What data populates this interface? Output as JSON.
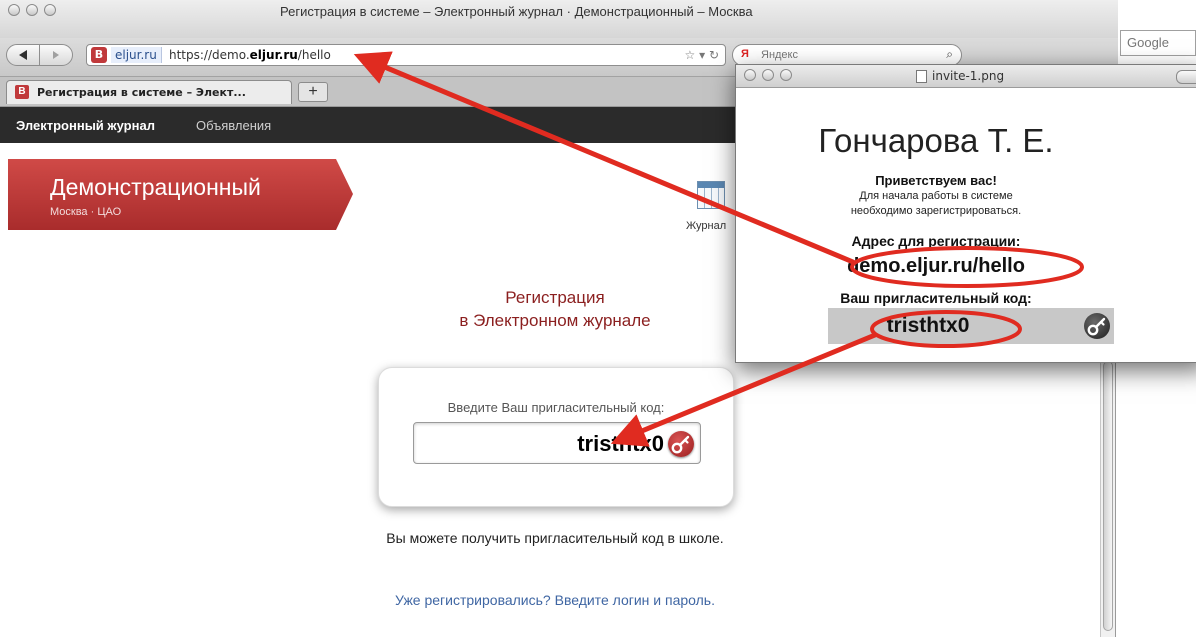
{
  "browser": {
    "window_title": "Регистрация в системе – Электронный журнал · Демонстрационный – Москва",
    "url_domain_tag": "eljur.ru",
    "url_prefix": "https://demo.",
    "url_domain": "eljur.ru",
    "url_path": "/hello",
    "site_badge": "В",
    "search_placeholder": "Яндекс",
    "side_search_placeholder": "Google",
    "tab_label": "Регистрация в системе – Элект...",
    "new_tab_label": "+"
  },
  "page": {
    "nav": {
      "home": "Электронный журнал",
      "news": "Объявления"
    },
    "school": {
      "title": "Демонстрационный",
      "subtitle": "Москва · ЦАО"
    },
    "journal_label": "Журнал",
    "registration": {
      "title": "Регистрация",
      "subtitle": "в Электронном журнале"
    },
    "invite": {
      "label": "Введите Ваш пригласительный код:",
      "value": "tristhtx0"
    },
    "hint": "Вы можете получить пригласительный код в школе.",
    "login_link": "Уже регистрировались? Введите логин и пароль."
  },
  "preview": {
    "window_title": "invite-1.png",
    "name": "Гончарова Т. Е.",
    "greeting": "Приветствуем вас!",
    "line1": "Для начала работы в системе",
    "line2": "необходимо зарегистрироваться.",
    "address_label": "Адрес для регистрации:",
    "address": "demo.eljur.ru/hello",
    "code_label": "Ваш пригласительный код:",
    "code": "tristhtx0"
  },
  "colors": {
    "brand_red": "#c0393b",
    "annotation_red": "#e02b20",
    "navbar_bg": "#2b2b2b",
    "title_red": "#8b1f1f",
    "link_blue": "#3f66a3"
  },
  "icons": {
    "back": "left-triangle-icon",
    "forward": "right-triangle-icon",
    "bookmark": "star-icon",
    "reload": "reload-icon",
    "home": "home-icon",
    "journal": "calendar-grid-icon",
    "key": "key-icon"
  }
}
